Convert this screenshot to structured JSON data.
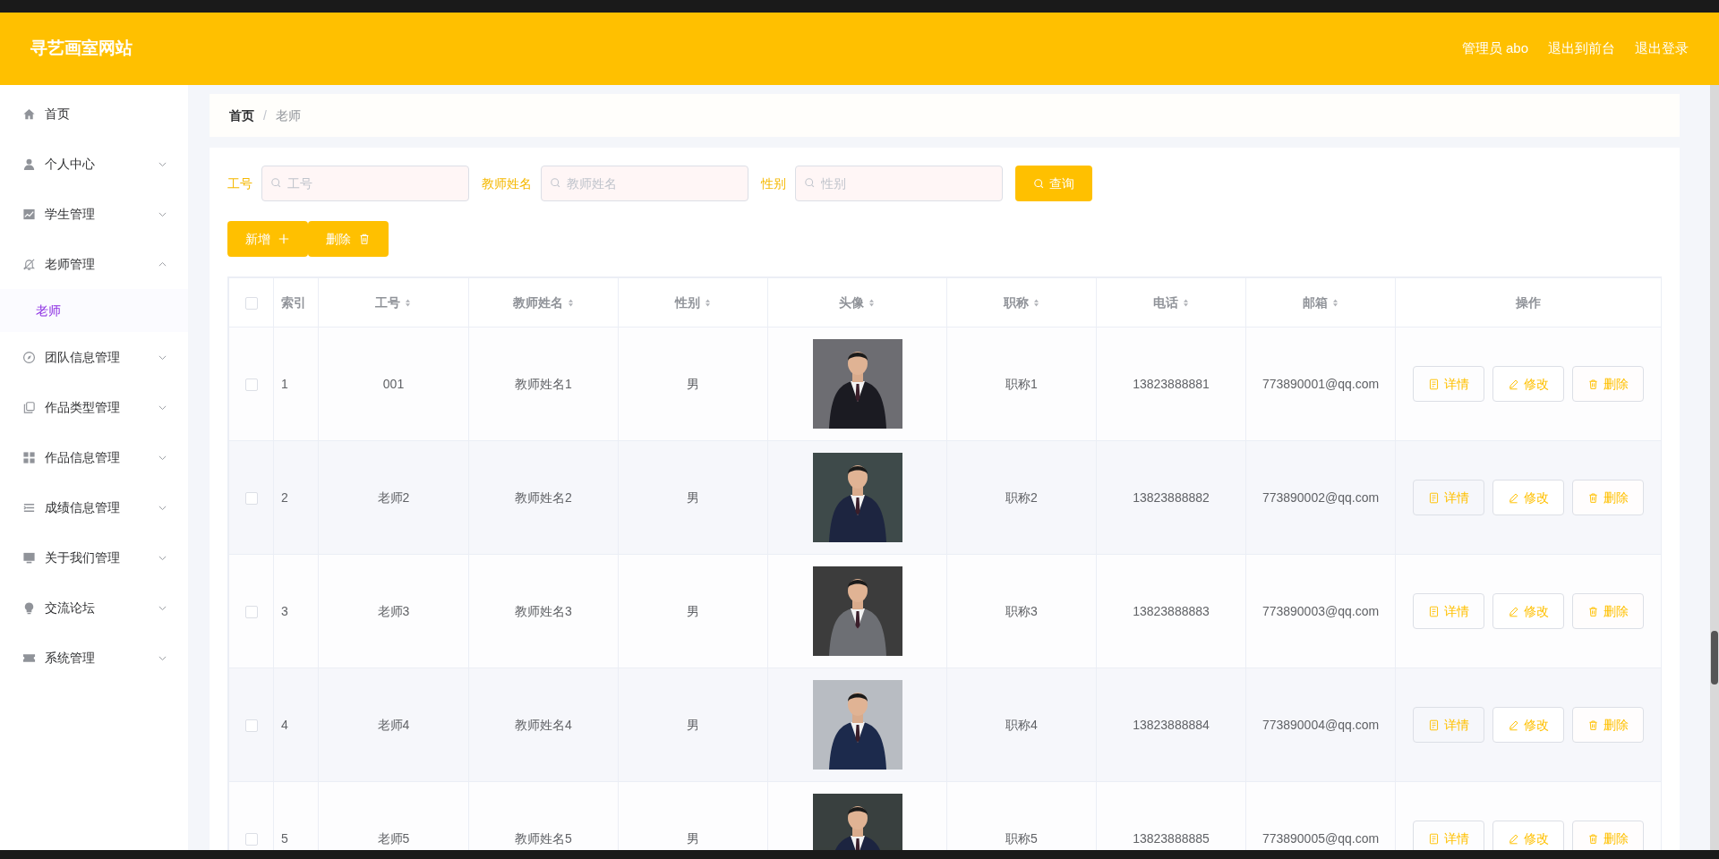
{
  "header": {
    "title": "寻艺画室网站",
    "links": [
      "管理员 abo",
      "退出到前台",
      "退出登录"
    ]
  },
  "sidebar": {
    "items": [
      {
        "label": "首页"
      },
      {
        "label": "个人中心",
        "expanded": false
      },
      {
        "label": "学生管理",
        "expanded": false
      },
      {
        "label": "老师管理",
        "expanded": true,
        "children": [
          {
            "label": "老师",
            "selected": true
          }
        ]
      },
      {
        "label": "团队信息管理",
        "expanded": false
      },
      {
        "label": "作品类型管理",
        "expanded": false
      },
      {
        "label": "作品信息管理",
        "expanded": false
      },
      {
        "label": "成绩信息管理",
        "expanded": false
      },
      {
        "label": "关于我们管理",
        "expanded": false
      },
      {
        "label": "交流论坛",
        "expanded": false
      },
      {
        "label": "系统管理",
        "expanded": false
      }
    ]
  },
  "breadcrumb": {
    "items": [
      "首页",
      "老师"
    ],
    "separator": "/"
  },
  "search": {
    "fields": [
      {
        "label": "工号",
        "placeholder": "工号"
      },
      {
        "label": "教师姓名",
        "placeholder": "教师姓名"
      },
      {
        "label": "性别",
        "placeholder": "性别"
      }
    ],
    "button": "查询"
  },
  "actions": [
    {
      "label": "新增",
      "kind": "add"
    },
    {
      "label": "删除",
      "kind": "delete"
    }
  ],
  "table": {
    "select_all_checked": false,
    "columns": [
      {
        "label": "索引",
        "sortable": false
      },
      {
        "label": "工号",
        "sortable": true
      },
      {
        "label": "教师姓名",
        "sortable": true
      },
      {
        "label": "性别",
        "sortable": true
      },
      {
        "label": "头像",
        "sortable": true
      },
      {
        "label": "职称",
        "sortable": true
      },
      {
        "label": "电话",
        "sortable": true
      },
      {
        "label": "邮箱",
        "sortable": true
      },
      {
        "label": "操作",
        "sortable": false
      }
    ],
    "rows": [
      {
        "checked": false,
        "index": "1",
        "id": "001",
        "name": "教师姓名1",
        "gender": "男",
        "title": "职称1",
        "phone": "13823888881",
        "email": "773890001@qq.com",
        "buttons": [
          "详情",
          "修改",
          "删除"
        ]
      },
      {
        "checked": false,
        "index": "2",
        "id": "老师2",
        "name": "教师姓名2",
        "gender": "男",
        "title": "职称2",
        "phone": "13823888882",
        "email": "773890002@qq.com",
        "buttons": [
          "详情",
          "修改",
          "删除"
        ]
      },
      {
        "checked": false,
        "index": "3",
        "id": "老师3",
        "name": "教师姓名3",
        "gender": "男",
        "title": "职称3",
        "phone": "13823888883",
        "email": "773890003@qq.com",
        "buttons": [
          "详情",
          "修改",
          "删除"
        ]
      },
      {
        "checked": false,
        "index": "4",
        "id": "老师4",
        "name": "教师姓名4",
        "gender": "男",
        "title": "职称4",
        "phone": "13823888884",
        "email": "773890004@qq.com",
        "buttons": [
          "详情",
          "修改",
          "删除"
        ]
      },
      {
        "checked": false,
        "index": "5",
        "id": "老师5",
        "name": "教师姓名5",
        "gender": "男",
        "title": "职称5",
        "phone": "13823888885",
        "email": "773890005@qq.com",
        "buttons": [
          "详情",
          "修改",
          "删除"
        ]
      }
    ]
  }
}
